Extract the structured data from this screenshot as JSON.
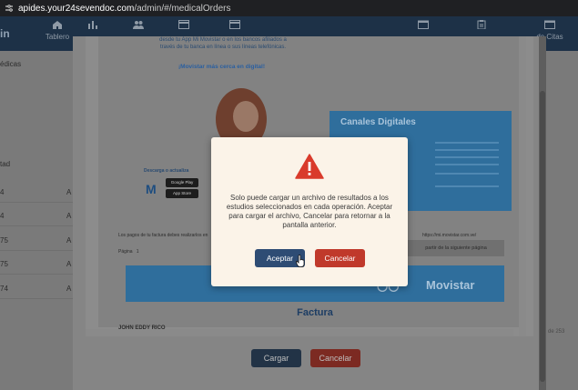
{
  "browser": {
    "url_host": "apides.your24sevendoc.com",
    "url_path": "/admin/#/medicalOrders"
  },
  "app": {
    "brand": "in",
    "nav": [
      {
        "label": "Tablero",
        "icon": "home-icon"
      },
      {
        "label": "",
        "icon": "bar-chart-icon"
      },
      {
        "label": "",
        "icon": "users-icon"
      },
      {
        "label": "",
        "icon": "card-icon"
      },
      {
        "label": "",
        "icon": "card-icon"
      },
      {
        "label": "",
        "icon": "calendar-icon"
      },
      {
        "label": "",
        "icon": "clipboard-icon"
      },
      {
        "label": "de Citas",
        "icon": "calendar-icon"
      }
    ],
    "left_rows": [
      "édicas",
      "tad",
      "4",
      "4",
      "75",
      "75",
      "74"
    ],
    "left_letters": [
      "A",
      "A",
      "A",
      "A",
      "A",
      "A"
    ],
    "pager_fragment": "de 253"
  },
  "document": {
    "promo_text": "desde tu App Mi Movistar o en los bancos afiliados a través de tu banca en línea o sus líneas telefónicas.",
    "promo_cta": "¡Movistar más cerca en digital!",
    "download_title": "Descarga o actualiza",
    "store_google": "Google Play",
    "store_apple": "App Store",
    "canales_title": "Canales Digitales",
    "footnote": "Los pagos de tu factura debes realizarlos en",
    "footnote_url": "https://mi.movistar.com.ve/",
    "pagina_label": "Página",
    "pagina_value": "1",
    "next_page": "partir de la siguiente página",
    "banner_brand": "Movistar",
    "factura_title": "Factura",
    "client_name": "JOHN EDDY RICO"
  },
  "doc_buttons": {
    "upload": "Cargar",
    "cancel": "Cancelar"
  },
  "alert": {
    "message": "Solo puede cargar un archivo de resultados a los estudios seleccionados en cada operación. Aceptar para cargar el archivo, Cancelar para retornar a la pantalla anterior.",
    "accept": "Aceptar",
    "cancel": "Cancelar",
    "icon": "warning-triangle-icon",
    "accept_color": "#2e4c74",
    "cancel_color": "#c0392b",
    "warning_color": "#d93a2b"
  }
}
